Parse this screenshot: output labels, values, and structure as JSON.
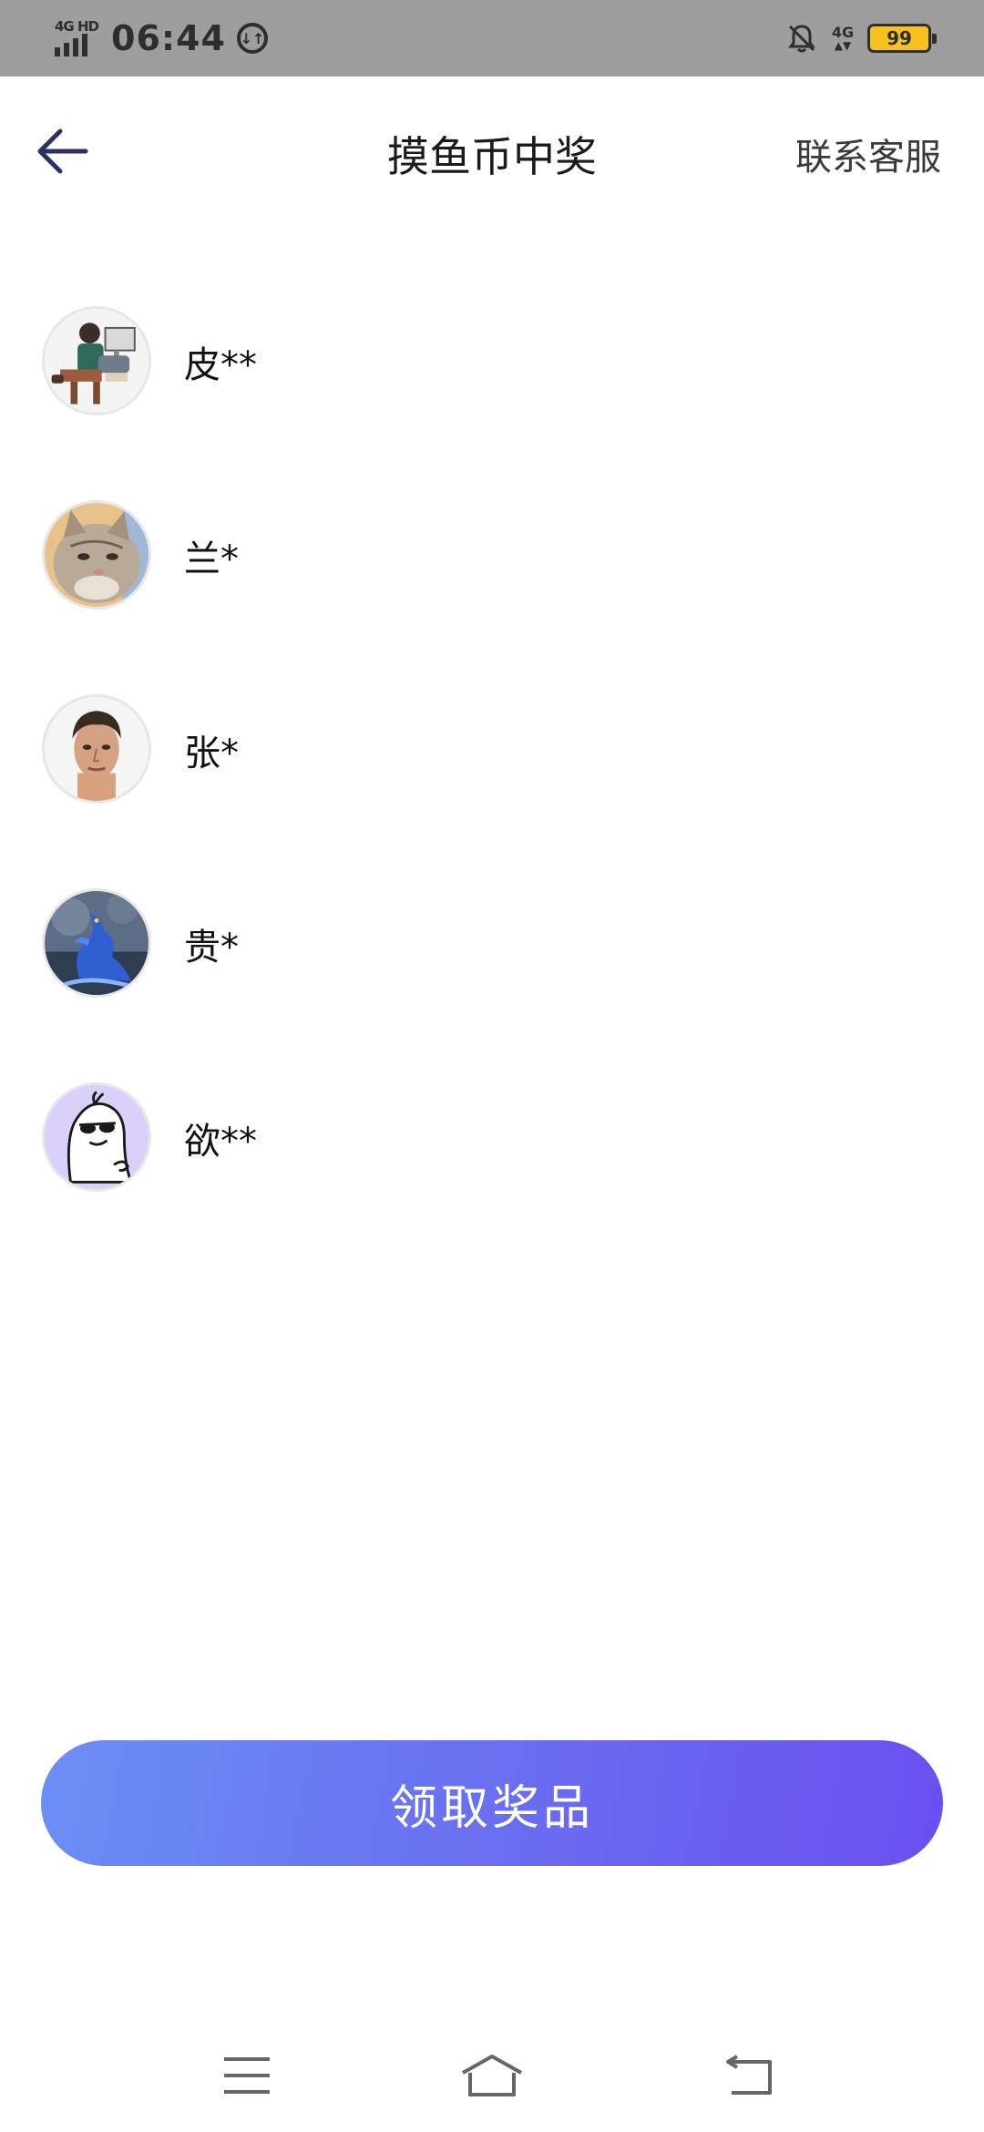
{
  "status_bar": {
    "network": "4G HD",
    "time": "06:44",
    "data_saver_glyph": "↓↑",
    "network_right": "4G",
    "battery": "99",
    "icons": [
      "signal-icon",
      "data-saver-icon",
      "bell-off-icon",
      "mobile-data-icon",
      "battery-icon"
    ]
  },
  "header": {
    "title": "摸鱼币中奖",
    "contact_label": "联系客服",
    "back_icon": "back-arrow-icon"
  },
  "winners": [
    {
      "name": "皮**",
      "avatar": "avatar-medical-illustration"
    },
    {
      "name": "兰*",
      "avatar": "avatar-cat"
    },
    {
      "name": "张*",
      "avatar": "avatar-man-portrait"
    },
    {
      "name": "贵*",
      "avatar": "avatar-blue-dragon"
    },
    {
      "name": "欲**",
      "avatar": "avatar-cartoon-ghost-sunglasses"
    }
  ],
  "claim_button": {
    "label": "领取奖品"
  },
  "nav_bar": {
    "icons": [
      "menu-icon",
      "home-icon",
      "back-icon"
    ]
  },
  "colors": {
    "status_bar": "#9e9e9e",
    "button_gradient_start": "#6b8ff5",
    "button_gradient_end": "#6a4ff0",
    "back_arrow": "#2b3262",
    "battery": "#f6c21b"
  }
}
